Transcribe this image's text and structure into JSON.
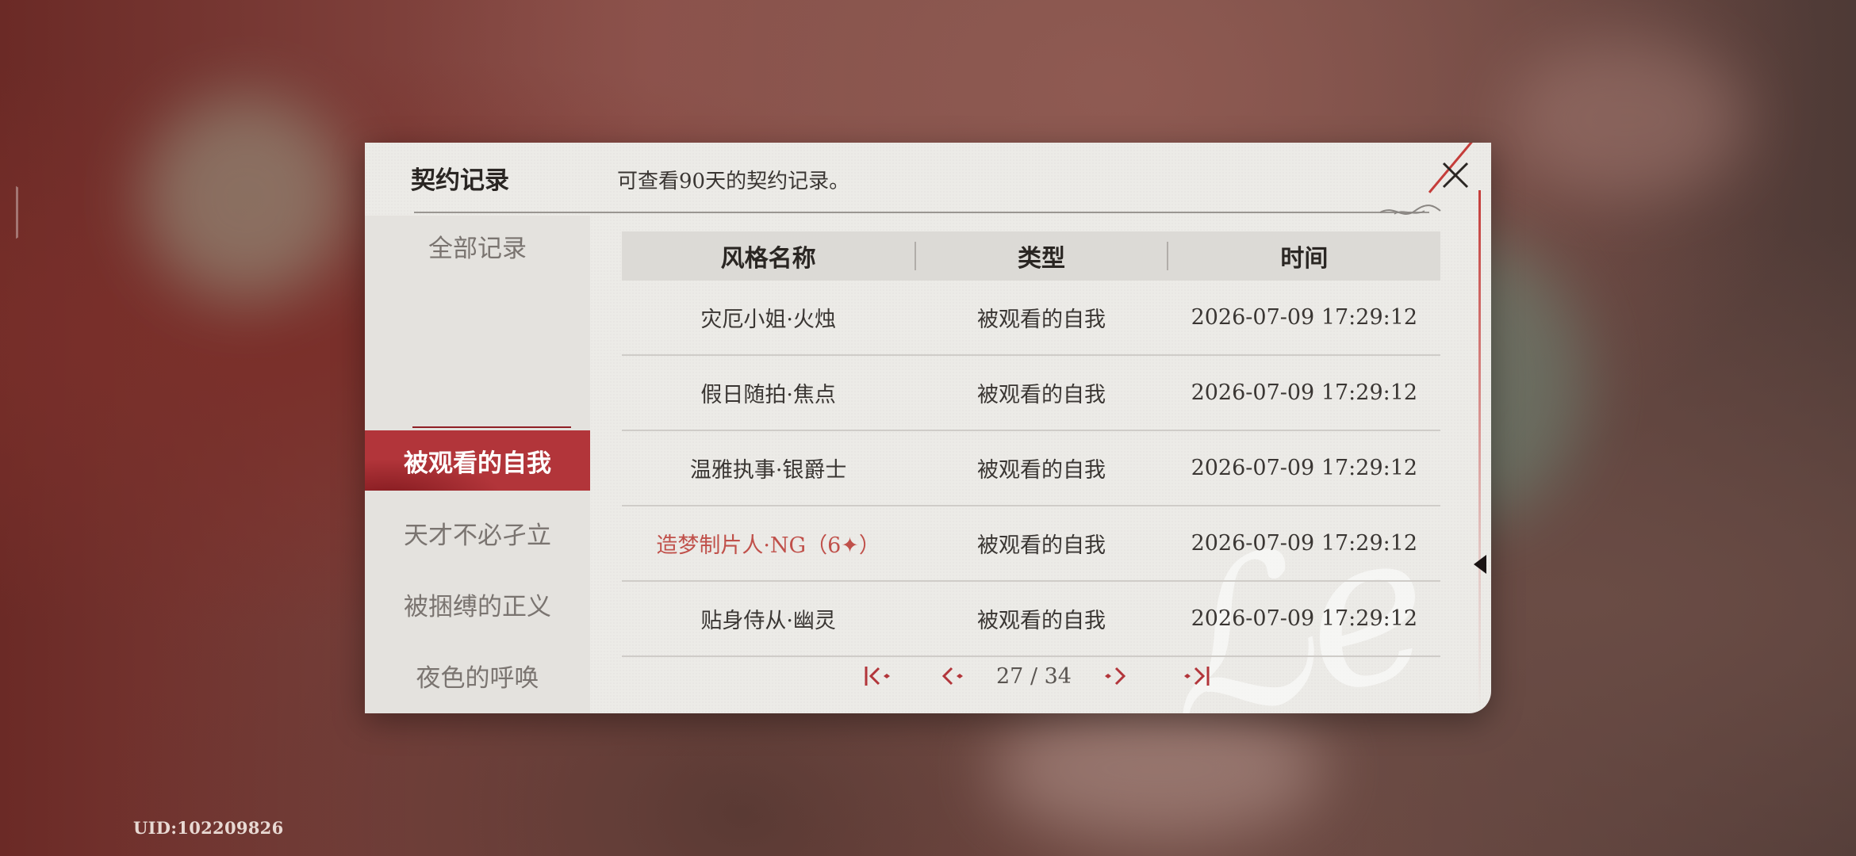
{
  "dialog": {
    "title": "契约记录",
    "description": "可查看90天的契约记录。"
  },
  "sidebar": {
    "items": [
      {
        "label": "全部记录",
        "active": false
      },
      {
        "label": "被观看的自我",
        "active": true
      },
      {
        "label": "天才不必孑立",
        "active": false
      },
      {
        "label": "被捆缚的正义",
        "active": false
      },
      {
        "label": "夜色的呼唤",
        "active": false
      }
    ]
  },
  "table": {
    "headers": [
      "风格名称",
      "类型",
      "时间"
    ],
    "rows": [
      {
        "name": "灾厄小姐·火烛",
        "type": "被观看的自我",
        "time": "2026-07-09 17:29:12",
        "highlight": false
      },
      {
        "name": "假日随拍·焦点",
        "type": "被观看的自我",
        "time": "2026-07-09 17:29:12",
        "highlight": false
      },
      {
        "name": "温雅执事·银爵士",
        "type": "被观看的自我",
        "time": "2026-07-09 17:29:12",
        "highlight": false
      },
      {
        "name": "造梦制片人·NG（6✦）",
        "type": "被观看的自我",
        "time": "2026-07-09 17:29:12",
        "highlight": true
      },
      {
        "name": "贴身侍从·幽灵",
        "type": "被观看的自我",
        "time": "2026-07-09 17:29:12",
        "highlight": false
      }
    ]
  },
  "pagination": {
    "current": 27,
    "total": 34,
    "text": "27 / 34"
  },
  "uid": "UID:102209826",
  "colors": {
    "accent": "#b2353a",
    "highlight_text": "#c0504a",
    "panel": "#ecebe7"
  },
  "icons": [
    "close-icon",
    "first-page-icon",
    "prev-page-icon",
    "next-page-icon",
    "last-page-icon"
  ]
}
